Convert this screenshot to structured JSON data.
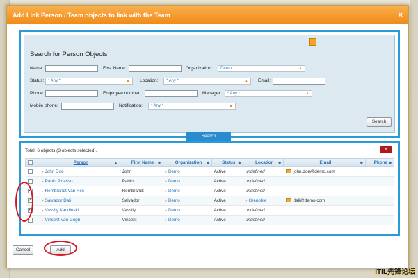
{
  "dialog": {
    "title": "Add Link Person / Team objects to link with the Team",
    "close_glyph": "×"
  },
  "search": {
    "heading": "Search for Person Objects",
    "labels": {
      "name": "Name:",
      "first_name": "First Name:",
      "organization": "Organization:",
      "status": "Status:",
      "location": "Location:",
      "email": "Email:",
      "phone": "Phone:",
      "employee_number": "Employee number:",
      "manager": "Manager:",
      "mobile_phone": "Mobile phone:",
      "notification": "Notification:"
    },
    "values": {
      "name": "",
      "first_name": "",
      "organization": "Demo",
      "status": "* Any *",
      "location": "* Any *",
      "email": "",
      "phone": "",
      "employee_number": "",
      "manager": "* Any *",
      "mobile_phone": "",
      "notification": "* Any *"
    },
    "search_button": "Search",
    "tab_label": "Search"
  },
  "results": {
    "total_text": "Total: 6 objects (3 objects selected).",
    "columns": [
      "Person",
      "First Name",
      "Organization",
      "Status",
      "Location",
      "Email",
      "Phone"
    ],
    "rows": [
      {
        "person": "John Doe",
        "first_name": "John",
        "organization": "Demo",
        "status": "Active",
        "location": "undefined",
        "email": "john.doe@demo.com",
        "phone": "",
        "checked": false
      },
      {
        "person": "Pablo Picasso",
        "first_name": "Pablo",
        "organization": "Demo",
        "status": "Active",
        "location": "undefined",
        "email": "",
        "phone": "",
        "checked": false
      },
      {
        "person": "Rembrandt Van Rijn",
        "first_name": "Rembrandt",
        "organization": "Demo",
        "status": "Active",
        "location": "undefined",
        "email": "",
        "phone": "",
        "checked": true
      },
      {
        "person": "Salvador Dali",
        "first_name": "Salvador",
        "organization": "Demo",
        "status": "Active",
        "location": "Grenoble",
        "email": "dali@demo.com",
        "phone": "",
        "checked": true
      },
      {
        "person": "Vassily Kandinski",
        "first_name": "Vassily",
        "organization": "Demo",
        "status": "Active",
        "location": "undefined",
        "email": "",
        "phone": "",
        "checked": true
      },
      {
        "person": "Vincent Van Gogh",
        "first_name": "Vincent",
        "organization": "Demo",
        "status": "Active",
        "location": "undefined",
        "email": "",
        "phone": "",
        "checked": false
      }
    ]
  },
  "footer": {
    "cancel": "Cancel",
    "add": "Add"
  },
  "watermark": "ITIL先锋论坛",
  "colors": {
    "titlebar": "#f08a18",
    "frame_blue": "#2a9bd6",
    "highlight_red": "#d8161f"
  }
}
